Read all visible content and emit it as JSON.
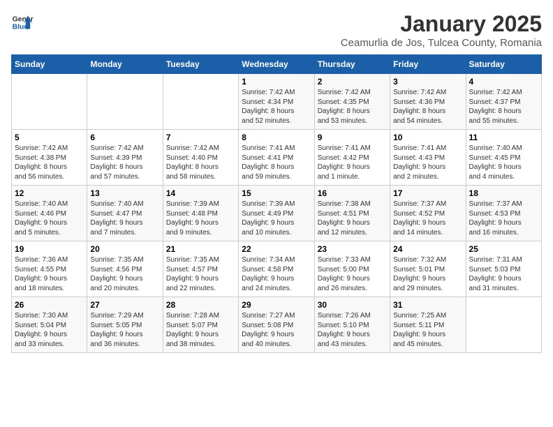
{
  "logo": {
    "line1": "General",
    "line2": "Blue"
  },
  "title": "January 2025",
  "subtitle": "Ceamurlia de Jos, Tulcea County, Romania",
  "weekdays": [
    "Sunday",
    "Monday",
    "Tuesday",
    "Wednesday",
    "Thursday",
    "Friday",
    "Saturday"
  ],
  "weeks": [
    [
      {
        "day": "",
        "info": ""
      },
      {
        "day": "",
        "info": ""
      },
      {
        "day": "",
        "info": ""
      },
      {
        "day": "1",
        "info": "Sunrise: 7:42 AM\nSunset: 4:34 PM\nDaylight: 8 hours\nand 52 minutes."
      },
      {
        "day": "2",
        "info": "Sunrise: 7:42 AM\nSunset: 4:35 PM\nDaylight: 8 hours\nand 53 minutes."
      },
      {
        "day": "3",
        "info": "Sunrise: 7:42 AM\nSunset: 4:36 PM\nDaylight: 8 hours\nand 54 minutes."
      },
      {
        "day": "4",
        "info": "Sunrise: 7:42 AM\nSunset: 4:37 PM\nDaylight: 8 hours\nand 55 minutes."
      }
    ],
    [
      {
        "day": "5",
        "info": "Sunrise: 7:42 AM\nSunset: 4:38 PM\nDaylight: 8 hours\nand 56 minutes."
      },
      {
        "day": "6",
        "info": "Sunrise: 7:42 AM\nSunset: 4:39 PM\nDaylight: 8 hours\nand 57 minutes."
      },
      {
        "day": "7",
        "info": "Sunrise: 7:42 AM\nSunset: 4:40 PM\nDaylight: 8 hours\nand 58 minutes."
      },
      {
        "day": "8",
        "info": "Sunrise: 7:41 AM\nSunset: 4:41 PM\nDaylight: 8 hours\nand 59 minutes."
      },
      {
        "day": "9",
        "info": "Sunrise: 7:41 AM\nSunset: 4:42 PM\nDaylight: 9 hours\nand 1 minute."
      },
      {
        "day": "10",
        "info": "Sunrise: 7:41 AM\nSunset: 4:43 PM\nDaylight: 9 hours\nand 2 minutes."
      },
      {
        "day": "11",
        "info": "Sunrise: 7:40 AM\nSunset: 4:45 PM\nDaylight: 9 hours\nand 4 minutes."
      }
    ],
    [
      {
        "day": "12",
        "info": "Sunrise: 7:40 AM\nSunset: 4:46 PM\nDaylight: 9 hours\nand 5 minutes."
      },
      {
        "day": "13",
        "info": "Sunrise: 7:40 AM\nSunset: 4:47 PM\nDaylight: 9 hours\nand 7 minutes."
      },
      {
        "day": "14",
        "info": "Sunrise: 7:39 AM\nSunset: 4:48 PM\nDaylight: 9 hours\nand 9 minutes."
      },
      {
        "day": "15",
        "info": "Sunrise: 7:39 AM\nSunset: 4:49 PM\nDaylight: 9 hours\nand 10 minutes."
      },
      {
        "day": "16",
        "info": "Sunrise: 7:38 AM\nSunset: 4:51 PM\nDaylight: 9 hours\nand 12 minutes."
      },
      {
        "day": "17",
        "info": "Sunrise: 7:37 AM\nSunset: 4:52 PM\nDaylight: 9 hours\nand 14 minutes."
      },
      {
        "day": "18",
        "info": "Sunrise: 7:37 AM\nSunset: 4:53 PM\nDaylight: 9 hours\nand 16 minutes."
      }
    ],
    [
      {
        "day": "19",
        "info": "Sunrise: 7:36 AM\nSunset: 4:55 PM\nDaylight: 9 hours\nand 18 minutes."
      },
      {
        "day": "20",
        "info": "Sunrise: 7:35 AM\nSunset: 4:56 PM\nDaylight: 9 hours\nand 20 minutes."
      },
      {
        "day": "21",
        "info": "Sunrise: 7:35 AM\nSunset: 4:57 PM\nDaylight: 9 hours\nand 22 minutes."
      },
      {
        "day": "22",
        "info": "Sunrise: 7:34 AM\nSunset: 4:58 PM\nDaylight: 9 hours\nand 24 minutes."
      },
      {
        "day": "23",
        "info": "Sunrise: 7:33 AM\nSunset: 5:00 PM\nDaylight: 9 hours\nand 26 minutes."
      },
      {
        "day": "24",
        "info": "Sunrise: 7:32 AM\nSunset: 5:01 PM\nDaylight: 9 hours\nand 29 minutes."
      },
      {
        "day": "25",
        "info": "Sunrise: 7:31 AM\nSunset: 5:03 PM\nDaylight: 9 hours\nand 31 minutes."
      }
    ],
    [
      {
        "day": "26",
        "info": "Sunrise: 7:30 AM\nSunset: 5:04 PM\nDaylight: 9 hours\nand 33 minutes."
      },
      {
        "day": "27",
        "info": "Sunrise: 7:29 AM\nSunset: 5:05 PM\nDaylight: 9 hours\nand 36 minutes."
      },
      {
        "day": "28",
        "info": "Sunrise: 7:28 AM\nSunset: 5:07 PM\nDaylight: 9 hours\nand 38 minutes."
      },
      {
        "day": "29",
        "info": "Sunrise: 7:27 AM\nSunset: 5:08 PM\nDaylight: 9 hours\nand 40 minutes."
      },
      {
        "day": "30",
        "info": "Sunrise: 7:26 AM\nSunset: 5:10 PM\nDaylight: 9 hours\nand 43 minutes."
      },
      {
        "day": "31",
        "info": "Sunrise: 7:25 AM\nSunset: 5:11 PM\nDaylight: 9 hours\nand 45 minutes."
      },
      {
        "day": "",
        "info": ""
      }
    ]
  ]
}
